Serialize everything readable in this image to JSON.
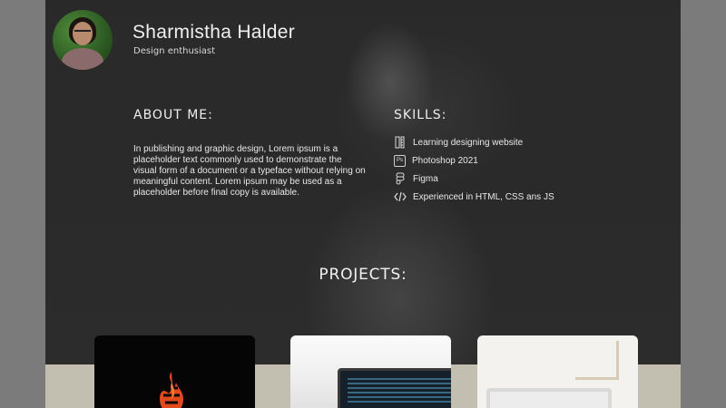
{
  "profile": {
    "name": "Sharmistha Halder",
    "tagline": "Design enthusiast"
  },
  "about": {
    "title": "ABOUT  ME:",
    "text": "In publishing and graphic design, Lorem ipsum is a placeholder text commonly used to demonstrate the visual form of a document or a typeface without relying on meaningful content. Lorem ipsum may be used as a placeholder before final copy is available."
  },
  "skills": {
    "title": "SKILLS:",
    "items": [
      {
        "label": "Learning designing website",
        "icon": "pencil-ruler-icon"
      },
      {
        "label": "Photoshop 2021",
        "icon": "photoshop-icon"
      },
      {
        "label": "Figma",
        "icon": "figma-icon"
      },
      {
        "label": "Experienced in HTML, CSS ans JS",
        "icon": "code-icon"
      }
    ]
  },
  "projects": {
    "title": "PROJECTS:",
    "cards": [
      {
        "image": "flame-logo-project"
      },
      {
        "image": "laptop-code-project"
      },
      {
        "image": "desk-laptop-project"
      }
    ]
  },
  "colors": {
    "page_background": "#7b7b7b",
    "hero_background": "#2d2d2d",
    "footer_band": "#c2bfb1"
  }
}
